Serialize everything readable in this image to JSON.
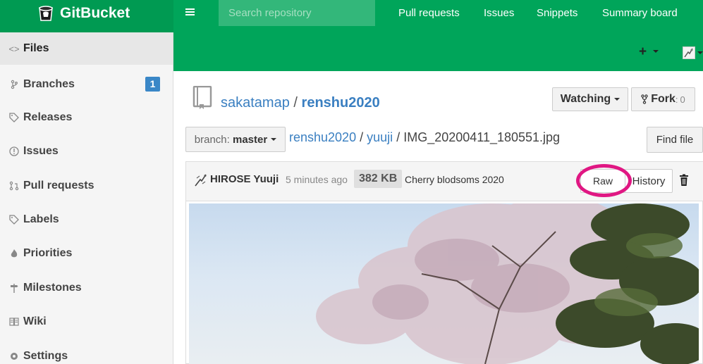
{
  "app": {
    "name": "GitBucket"
  },
  "search": {
    "placeholder": "Search repository"
  },
  "topnav": {
    "items": [
      {
        "label": "Pull requests"
      },
      {
        "label": "Issues"
      },
      {
        "label": "Snippets"
      },
      {
        "label": "Summary board"
      }
    ]
  },
  "header": {
    "new_menu": "+"
  },
  "sidebar": {
    "items": [
      {
        "label": "Files",
        "icon": "code-icon"
      },
      {
        "label": "Branches",
        "icon": "branch-icon",
        "badge": "1"
      },
      {
        "label": "Releases",
        "icon": "tag-icon"
      },
      {
        "label": "Issues",
        "icon": "issue-icon"
      },
      {
        "label": "Pull requests",
        "icon": "pull-request-icon"
      },
      {
        "label": "Labels",
        "icon": "tag-icon"
      },
      {
        "label": "Priorities",
        "icon": "flame-icon"
      },
      {
        "label": "Milestones",
        "icon": "milestone-icon"
      },
      {
        "label": "Wiki",
        "icon": "book-icon"
      },
      {
        "label": "Settings",
        "icon": "gear-icon"
      }
    ]
  },
  "repo": {
    "owner": "sakatamap",
    "separator": "/",
    "name": "renshu2020",
    "watch_label": "Watching",
    "fork_label": "Fork",
    "fork_sep": ":",
    "fork_count": "0"
  },
  "branch": {
    "prefix": "branch:",
    "name": "master"
  },
  "breadcrumb": {
    "repo": "renshu2020",
    "sep1": "/",
    "folder": "yuuji",
    "sep2": "/",
    "file": "IMG_20200411_180551.jpg"
  },
  "find_file_label": "Find file",
  "commit": {
    "author": "HIROSE Yuuji",
    "time": "5 minutes ago",
    "size": "382 KB",
    "message": "Cherry blodsoms 2020"
  },
  "file_actions": {
    "raw": "Raw",
    "history": "History"
  },
  "colors": {
    "brand_green": "#00a55a",
    "link_blue": "#3a7fc1",
    "badge_blue": "#3a87c7",
    "highlight_ring": "#e01783"
  }
}
